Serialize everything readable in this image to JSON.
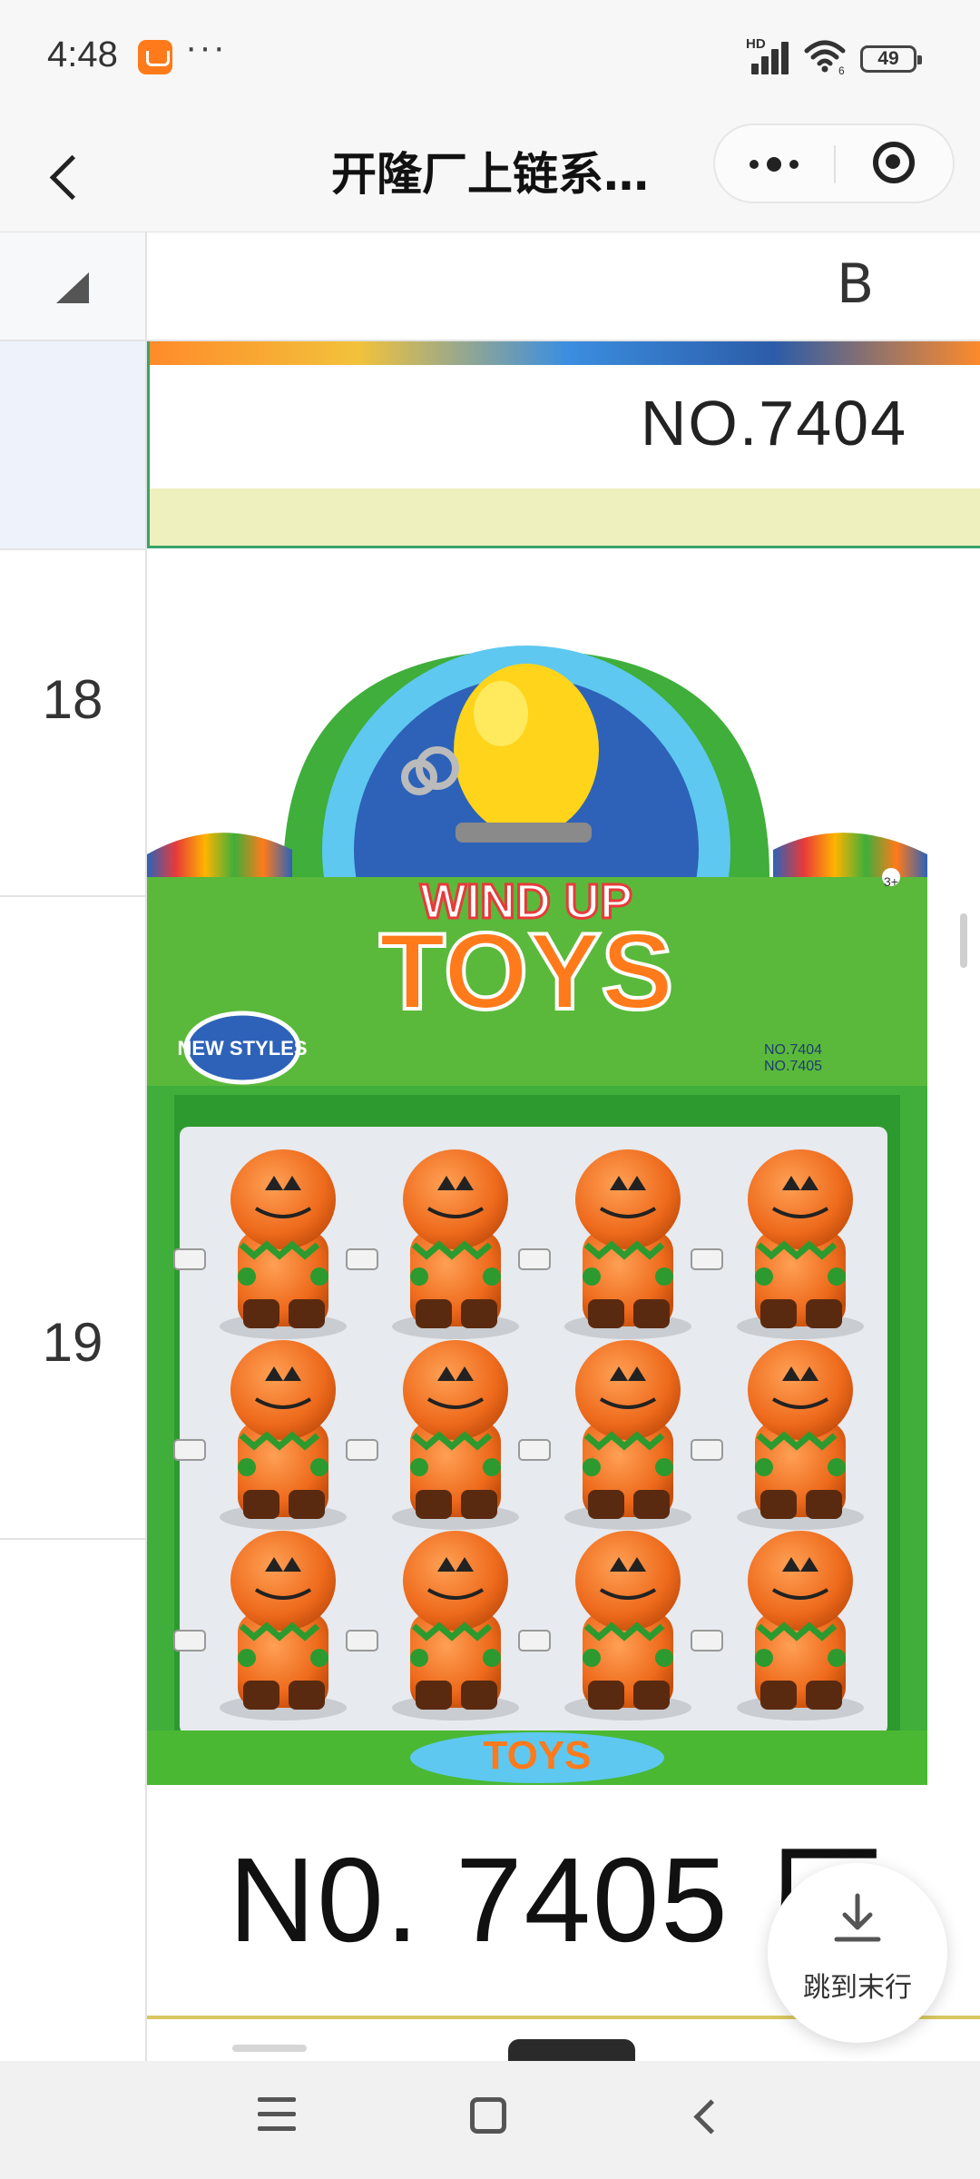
{
  "status_bar": {
    "time": "4:48",
    "more": "···",
    "network_label": "HD",
    "wifi_label": "6",
    "battery": "49"
  },
  "nav": {
    "title": "开隆厂上链系…"
  },
  "sheet": {
    "column_header": "B",
    "rows": [
      {
        "number": "18"
      },
      {
        "number": "19"
      }
    ],
    "top_cell_label": "NO.7404",
    "product_caption": "N0. 7405 厂",
    "product_image": {
      "box_headline_top": "WIND UP",
      "box_headline_bottom": "TOYS",
      "badge": "NEW STYLES",
      "model_line_1": "NO.7404",
      "model_line_2": "NO.7405",
      "age_badge": "3+",
      "pumpkin_rows": 3,
      "pumpkin_cols": 4
    }
  },
  "jump_button": {
    "label": "跳到末行"
  },
  "icons": {
    "back": "chevron-left-icon",
    "more": "more-dots-icon",
    "close": "target-icon",
    "download": "download-icon"
  },
  "colors": {
    "box_green": "#3fae3a",
    "box_blue": "#2d62b8",
    "pumpkin": "#ee6a1c",
    "selection_green": "#3aa26a"
  }
}
